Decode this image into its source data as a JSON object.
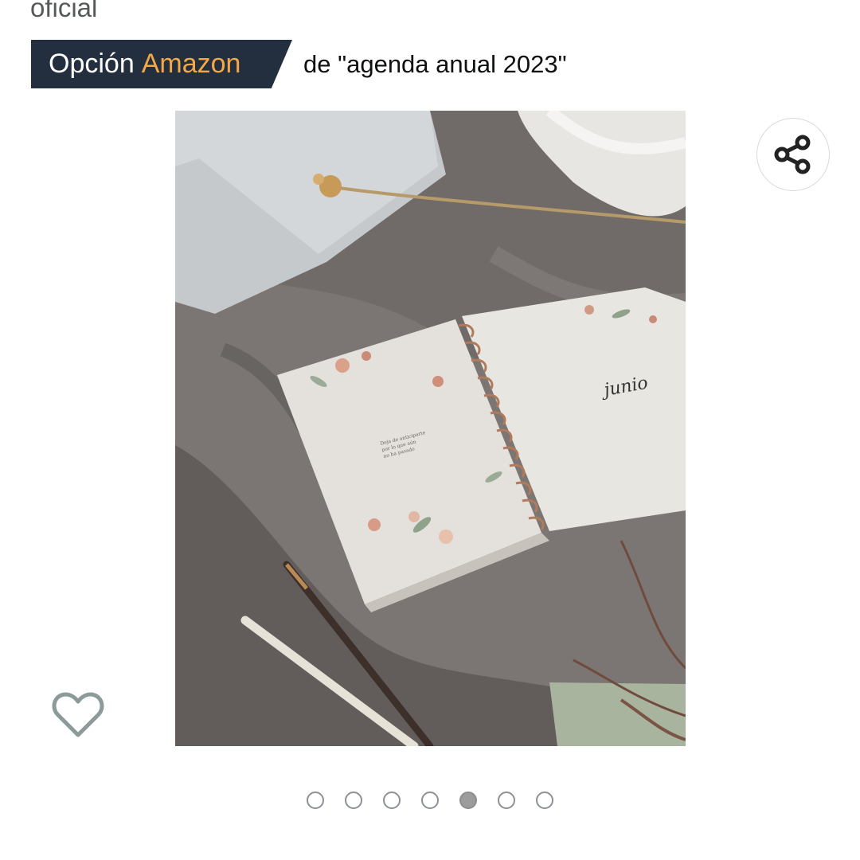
{
  "header": {
    "brand_link": "oficial"
  },
  "badge": {
    "word1": "Opción",
    "word2": "Amazon",
    "query_text": "de \"agenda anual 2023\"",
    "colors": {
      "background": "#232f3e",
      "accent": "#f3a847",
      "text": "#ffffff"
    }
  },
  "image": {
    "notebook_word": "junio",
    "caption_text": [
      "Deja de anticiparte",
      "por lo que aún",
      "no ha pasado"
    ]
  },
  "actions": {
    "share_icon": "share-icon",
    "wishlist_icon": "heart-outline-icon"
  },
  "carousel": {
    "total": 7,
    "active_index": 4
  }
}
